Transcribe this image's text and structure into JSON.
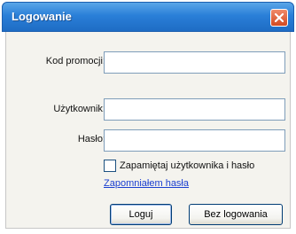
{
  "window": {
    "title": "Logowanie"
  },
  "form": {
    "promo_label": "Kod promocji:",
    "user_label": "Użytkownik:",
    "password_label": "Hasło:",
    "promo_value": "",
    "user_value": "",
    "password_value": "",
    "remember_label": "Zapamiętaj użytkownika i hasło",
    "remember_checked": false,
    "forgot_link": "Zapomniałem hasła"
  },
  "buttons": {
    "login": "Loguj",
    "no_login": "Bez logowania"
  }
}
